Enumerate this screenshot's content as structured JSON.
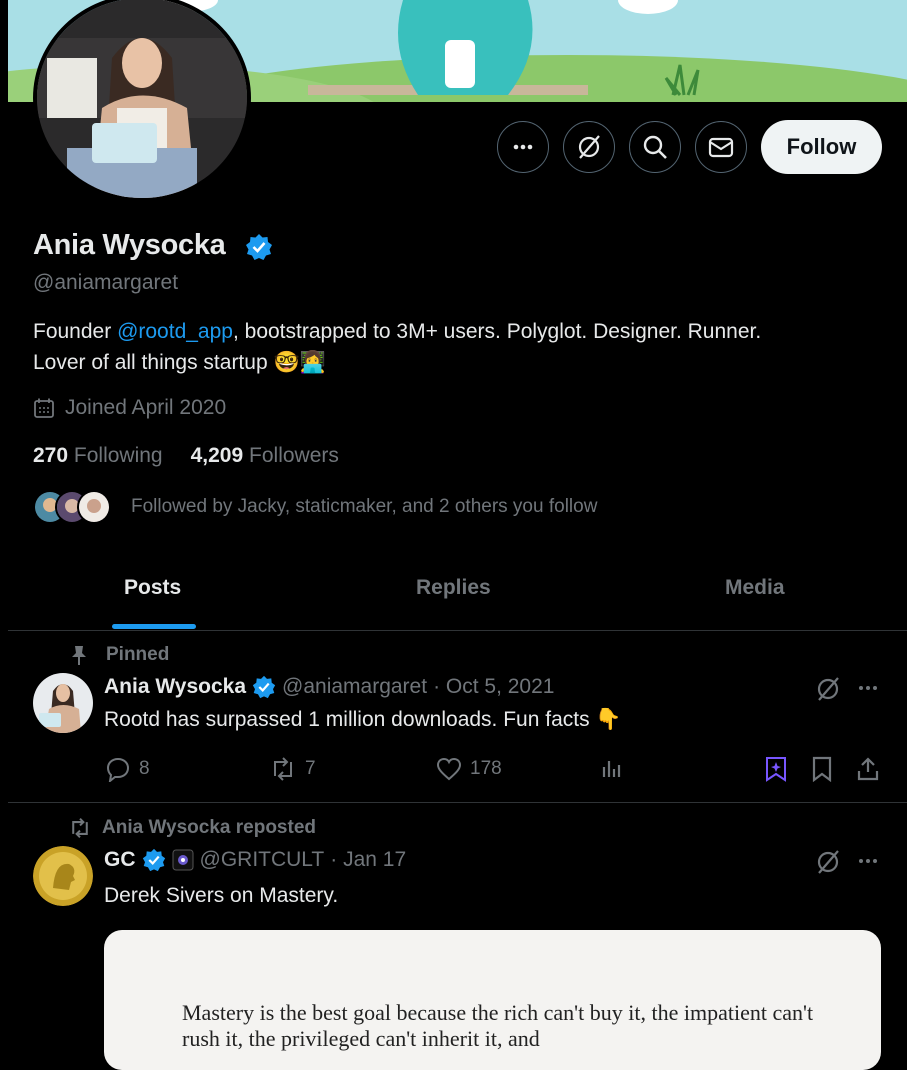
{
  "profile": {
    "display_name": "Ania Wysocka",
    "handle": "@aniamargaret",
    "bio_prefix": "Founder ",
    "bio_link": "@rootd_app",
    "bio_suffix": ", bootstrapped to 3M+ users. Polyglot. Designer. Runner.",
    "bio_line2": "Lover of all things startup 🤓👩‍💻",
    "joined": "Joined April 2020",
    "following_count": "270",
    "following_label": "Following",
    "followers_count": "4,209",
    "followers_label": "Followers",
    "followed_by": "Followed by Jacky, staticmaker, and 2 others you follow"
  },
  "actions": {
    "follow_label": "Follow"
  },
  "tabs": [
    {
      "label": "Posts"
    },
    {
      "label": "Replies"
    },
    {
      "label": "Media"
    }
  ],
  "tweets": [
    {
      "context": "Pinned",
      "name": "Ania Wysocka",
      "handle": "@aniamargaret",
      "date": "· Oct 5, 2021",
      "text": "Rootd has surpassed 1 million downloads. Fun facts 👇",
      "replies": "8",
      "reposts": "7",
      "likes": "178"
    },
    {
      "context": "Ania Wysocka reposted",
      "name": "GC",
      "handle": "@GRITCULT",
      "date": "· Jan 17",
      "text": "Derek Sivers on Mastery.",
      "quote_text": "Mastery is the best goal because the rich can't buy it, the impatient can't rush it, the privileged can't inherit it, and"
    }
  ],
  "colors": {
    "accent": "#1d9bf0",
    "background": "#000000",
    "text": "#e7e9ea",
    "muted": "#71767b",
    "border": "#2f3336",
    "follow_bg": "#eff3f4"
  },
  "icons": [
    "more-icon",
    "grok-icon",
    "search-icon",
    "message-icon",
    "verified-icon",
    "calendar-icon",
    "pin-icon",
    "reply-icon",
    "repost-icon",
    "like-icon",
    "views-icon",
    "grok-bookmark-icon",
    "bookmark-icon",
    "share-icon"
  ]
}
